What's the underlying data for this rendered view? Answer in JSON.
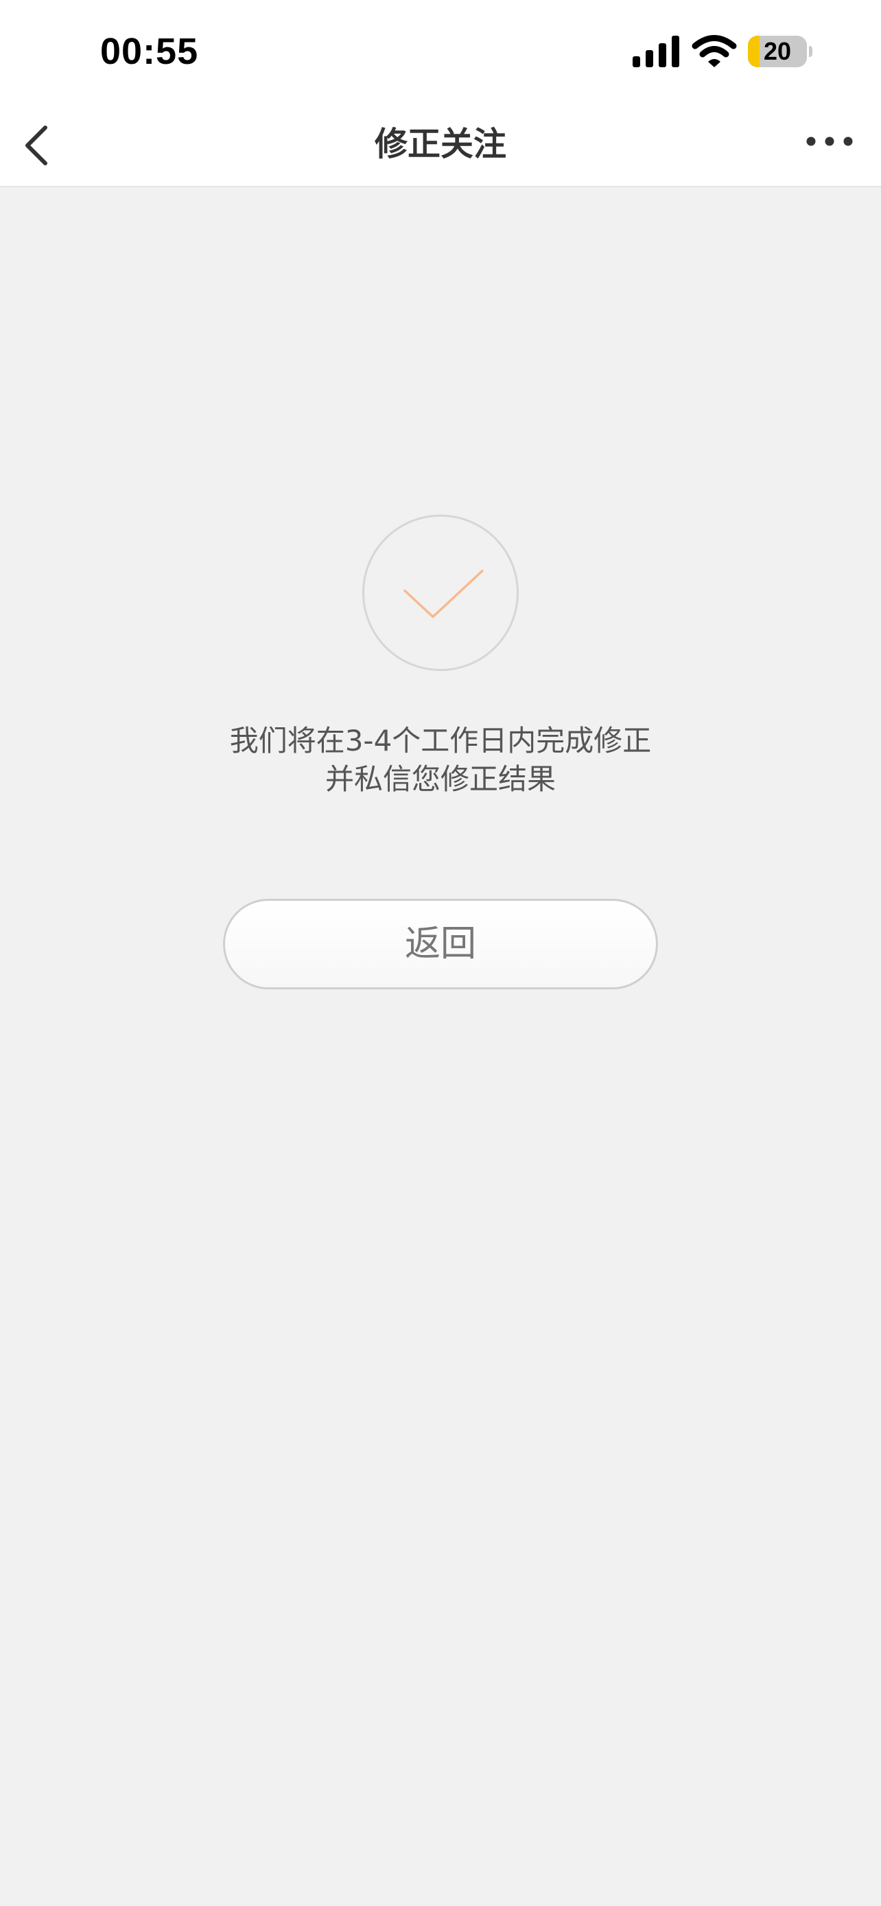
{
  "status_bar": {
    "time": "00:55",
    "battery_level": "20",
    "battery_fraction": 0.2,
    "icons": [
      "signal-icon",
      "wifi-icon",
      "battery-icon"
    ]
  },
  "nav": {
    "title": "修正关注",
    "back_icon": "chevron-left-icon",
    "more_icon": "more-horizontal-icon"
  },
  "result": {
    "icon": "check-icon",
    "message_line1": "我们将在3-4个工作日内完成修正",
    "message_line2": "并私信您修正结果",
    "return_label": "返回"
  },
  "colors": {
    "accent": "#f8b98e",
    "background": "#f1f1f1",
    "battery": "#f7c600"
  }
}
